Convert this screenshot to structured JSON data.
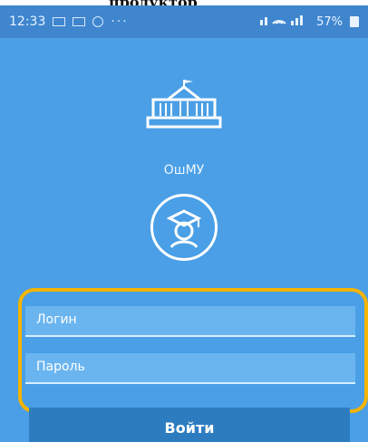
{
  "top_text": "продуктор",
  "statusbar": {
    "time": "12:33",
    "dots": "···",
    "battery": "57%"
  },
  "app": {
    "university": "ОшМУ"
  },
  "login": {
    "username_placeholder": "Логин",
    "password_placeholder": "Пароль",
    "button_label": "Войти"
  },
  "colors": {
    "background": "#4a9fe6",
    "statusbar": "#3f86cf",
    "field": "#6ab5f0",
    "button": "#2d7cc0",
    "highlight": "#f4b400"
  },
  "icons": {
    "building": "university-building-icon",
    "avatar": "graduate-avatar-icon"
  }
}
